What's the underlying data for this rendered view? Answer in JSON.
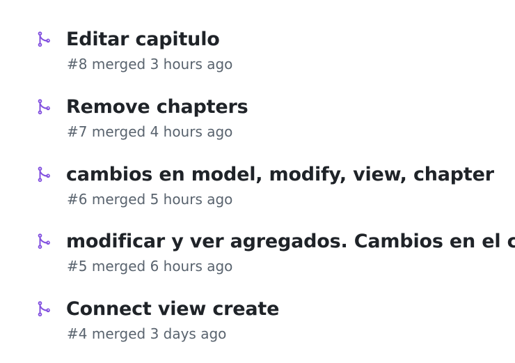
{
  "colors": {
    "merged_icon": "#8250df",
    "title_text": "#1f2328",
    "meta_text": "#59636e",
    "background": "#ffffff"
  },
  "pull_requests": [
    {
      "icon": "git-merge-icon",
      "title": "Editar capitulo",
      "number": "#8",
      "status": "merged",
      "time": "3 hours ago"
    },
    {
      "icon": "git-merge-icon",
      "title": "Remove chapters",
      "number": "#7",
      "status": "merged",
      "time": "4 hours ago"
    },
    {
      "icon": "git-merge-icon",
      "title": "cambios en model, modify, view, chapter",
      "number": "#6",
      "status": "merged",
      "time": "5 hours ago"
    },
    {
      "icon": "git-merge-icon",
      "title": "modificar y ver agregados. Cambios en el css",
      "number": "#5",
      "status": "merged",
      "time": "6 hours ago"
    },
    {
      "icon": "git-merge-icon",
      "title": "Connect view create",
      "number": "#4",
      "status": "merged",
      "time": "3 days ago"
    }
  ]
}
